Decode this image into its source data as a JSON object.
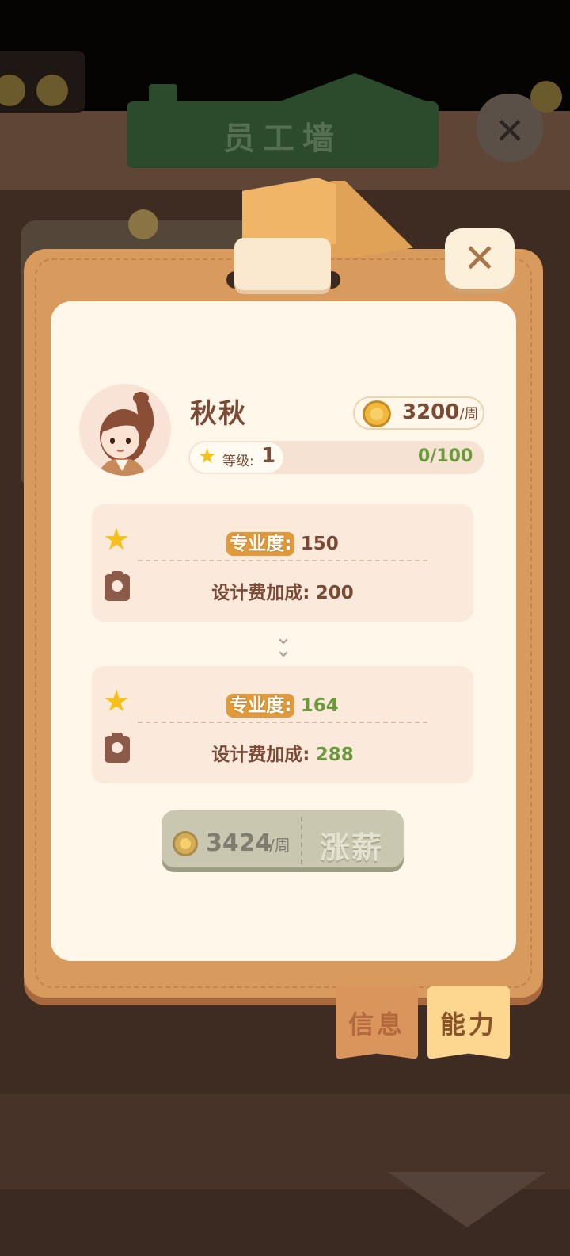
{
  "background": {
    "sign_title": "员工墙"
  },
  "dialog": {
    "close_icon": "close-icon"
  },
  "employee": {
    "name": "秋秋",
    "salary": "3200",
    "salary_unit": "/周",
    "level_label": "等级:",
    "level": "1",
    "exp": "0/100"
  },
  "current_stats": {
    "professionalism_label": "专业度:",
    "professionalism_value": "150",
    "design_bonus_label": "设计费加成:",
    "design_bonus_value": "200"
  },
  "next_stats": {
    "professionalism_label": "专业度:",
    "professionalism_value": "164",
    "design_bonus_label": "设计费加成:",
    "design_bonus_value": "288"
  },
  "raise_button": {
    "cost": "3424",
    "unit": "/周",
    "label": "涨薪"
  },
  "tabs": [
    {
      "label": "信息",
      "active": false
    },
    {
      "label": "能力",
      "active": true
    }
  ],
  "colors": {
    "accent_green": "#6a9a3c",
    "panel_orange": "#d99a5e",
    "paper": "#fff7e9"
  }
}
